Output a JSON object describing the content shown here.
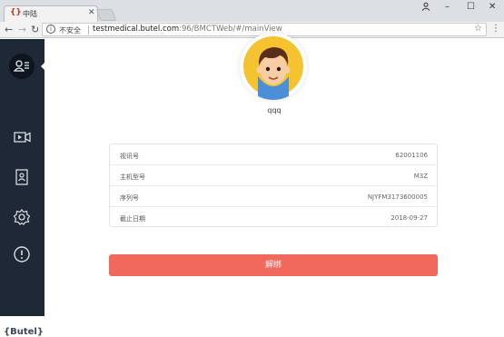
{
  "browser": {
    "tab_title": "中陆",
    "tab_favicon": "{}",
    "insecure_label": "不安全",
    "url_host": "testmedical.butel.com",
    "url_path": ":96/BMCTWeb/#/mainView"
  },
  "sidebar": {
    "items": [
      {
        "name": "profile",
        "icon": "user-list-icon"
      },
      {
        "name": "video",
        "icon": "video-icon"
      },
      {
        "name": "contacts",
        "icon": "contact-book-icon"
      },
      {
        "name": "settings",
        "icon": "gear-icon"
      },
      {
        "name": "about",
        "icon": "exclamation-circle-icon"
      }
    ],
    "brand": "{Butel}"
  },
  "profile": {
    "username": "qqq"
  },
  "device_info": {
    "rows": [
      {
        "label": "视讯号",
        "value": "62001106"
      },
      {
        "label": "主机型号",
        "value": "M3Z"
      },
      {
        "label": "序列号",
        "value": "NJYFM3173600005"
      },
      {
        "label": "截止日期",
        "value": "2018-09-27"
      }
    ]
  },
  "actions": {
    "unbind_label": "解绑"
  },
  "colors": {
    "sidebar_bg": "#1e2836",
    "unbind_button": "#f1695d"
  }
}
